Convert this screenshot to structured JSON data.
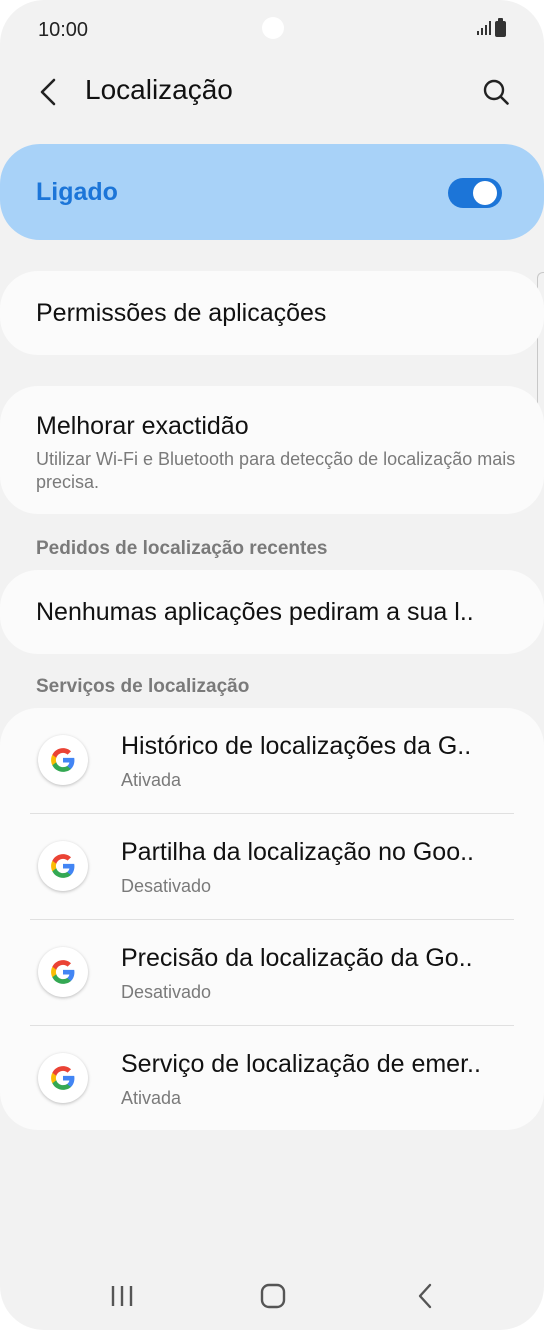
{
  "status_bar": {
    "time": "10:00"
  },
  "header": {
    "title": "Localização"
  },
  "master_toggle": {
    "label": "Ligado",
    "state": "on"
  },
  "app_permissions": {
    "title": "Permissões de aplicações"
  },
  "accuracy": {
    "title": "Melhorar exactidão",
    "subtitle": "Utilizar Wi-Fi e Bluetooth para detecção de localização mais precisa."
  },
  "recent": {
    "header": "Pedidos de localização recentes",
    "empty": "Nenhumas aplicações pediram a sua l.."
  },
  "services": {
    "header": "Serviços de localização",
    "items": [
      {
        "title": "Histórico de localizações da G..",
        "status": "Ativada",
        "icon": "google-g-icon"
      },
      {
        "title": "Partilha da localização no Goo..",
        "status": "Desativado",
        "icon": "google-g-icon"
      },
      {
        "title": "Precisão da localização da Go..",
        "status": "Desativado",
        "icon": "google-g-icon"
      },
      {
        "title": "Serviço de localização de emer..",
        "status": "Ativada",
        "icon": "google-g-icon"
      }
    ]
  },
  "colors": {
    "accent": "#1c75d8",
    "toggle_card_bg": "#a8d2f8",
    "background": "#f2f2f2",
    "card_bg": "#fbfbfb"
  }
}
